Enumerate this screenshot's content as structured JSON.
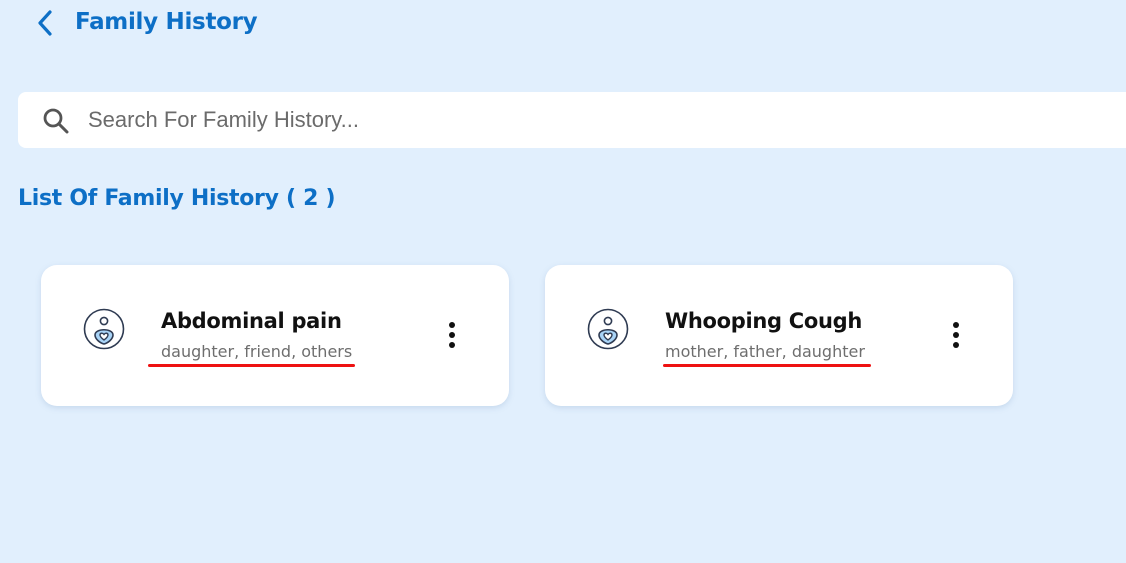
{
  "header": {
    "title": "Family History",
    "back_icon": "chevron-left-icon"
  },
  "search": {
    "placeholder": "Search For Family History...",
    "value": "",
    "icon": "search-icon"
  },
  "list": {
    "title": "List Of Family History ( 2 )",
    "items": [
      {
        "condition": "Abdominal pain",
        "relations": "daughter, friend, others",
        "icon": "family-health-icon"
      },
      {
        "condition": "Whooping Cough",
        "relations": "mother, father, daughter",
        "icon": "family-health-icon"
      }
    ]
  },
  "colors": {
    "background": "#e1effd",
    "accent": "#0d6fc6",
    "highlight": "#ee1111"
  }
}
